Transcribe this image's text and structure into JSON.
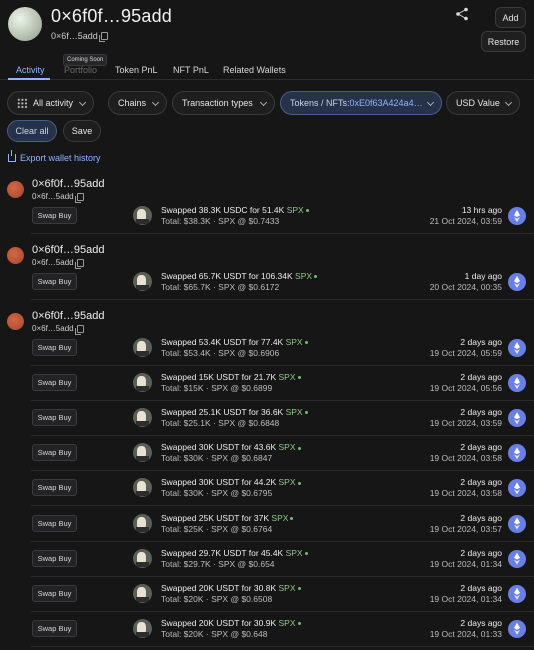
{
  "header": {
    "title": "0×6f0f…95add",
    "short_address": "0×6f…5add",
    "add_label": "Add",
    "restore_label": "Restore"
  },
  "tabs": [
    {
      "label": "Activity",
      "active": true
    },
    {
      "label": "Portfolio",
      "disabled": true
    },
    {
      "label": "Token PnL"
    },
    {
      "label": "NFT PnL"
    },
    {
      "label": "Related Wallets"
    }
  ],
  "tooltip": "Coming Soon",
  "filters": {
    "all_activity": "All activity",
    "chains": "Chains",
    "transaction_types": "Transaction types",
    "tokens_prefix": "Tokens / NFTs: ",
    "tokens_value": "0xE0f63A424a4…",
    "usd_value": "USD Value"
  },
  "actions": {
    "clear_all": "Clear all",
    "save": "Save",
    "export": "Export wallet history"
  },
  "colors": {
    "accent": "#8fb6ff",
    "spx": "#8fc98a",
    "eth": "#6a7fe6",
    "avatar": "#c45a38"
  },
  "groups": [
    {
      "name": "0×6f0f…95add",
      "sub": "0×6f…5add",
      "txs": [
        {
          "action": "Swap Buy",
          "from": "Swapped 38.3K USDC for 51.4K ",
          "token": "SPX",
          "total": "Total: $38.3K · SPX @ $0.7433",
          "when": "13 hrs ago",
          "date": "21 Oct 2024, 03:59"
        }
      ]
    },
    {
      "name": "0×6f0f…95add",
      "sub": "0×6f…5add",
      "txs": [
        {
          "action": "Swap Buy",
          "from": "Swapped 65.7K USDT for 106.34K ",
          "token": "SPX",
          "total": "Total: $65.7K · SPX @ $0.6172",
          "when": "1 day ago",
          "date": "20 Oct 2024, 00:35"
        }
      ]
    },
    {
      "name": "0×6f0f…95add",
      "sub": "0×6f…5add",
      "txs": [
        {
          "action": "Swap Buy",
          "from": "Swapped 53.4K USDT for 77.4K ",
          "token": "SPX",
          "total": "Total: $53.4K · SPX @ $0.6906",
          "when": "2 days ago",
          "date": "19 Oct 2024, 05:59"
        },
        {
          "action": "Swap Buy",
          "from": "Swapped 15K USDT for 21.7K ",
          "token": "SPX",
          "total": "Total: $15K · SPX @ $0.6899",
          "when": "2 days ago",
          "date": "19 Oct 2024, 05:56"
        },
        {
          "action": "Swap Buy",
          "from": "Swapped 25.1K USDT for 36.6K ",
          "token": "SPX",
          "total": "Total: $25.1K · SPX @ $0.6848",
          "when": "2 days ago",
          "date": "19 Oct 2024, 03:59"
        },
        {
          "action": "Swap Buy",
          "from": "Swapped 30K USDT for 43.6K ",
          "token": "SPX",
          "total": "Total: $30K · SPX @ $0.6847",
          "when": "2 days ago",
          "date": "19 Oct 2024, 03:58"
        },
        {
          "action": "Swap Buy",
          "from": "Swapped 30K USDT for 44.2K ",
          "token": "SPX",
          "total": "Total: $30K · SPX @ $0.6795",
          "when": "2 days ago",
          "date": "19 Oct 2024, 03:58"
        },
        {
          "action": "Swap Buy",
          "from": "Swapped 25K USDT for 37K ",
          "token": "SPX",
          "total": "Total: $25K · SPX @ $0.6764",
          "when": "2 days ago",
          "date": "19 Oct 2024, 03:57"
        },
        {
          "action": "Swap Buy",
          "from": "Swapped 29.7K USDT for 45.4K ",
          "token": "SPX",
          "total": "Total: $29.7K · SPX @ $0.654",
          "when": "2 days ago",
          "date": "19 Oct 2024, 01:34"
        },
        {
          "action": "Swap Buy",
          "from": "Swapped 20K USDT for 30.8K ",
          "token": "SPX",
          "total": "Total: $20K · SPX @ $0.6508",
          "when": "2 days ago",
          "date": "19 Oct 2024, 01:34"
        },
        {
          "action": "Swap Buy",
          "from": "Swapped 20K USDT for 30.9K ",
          "token": "SPX",
          "total": "Total: $20K · SPX @ $0.648",
          "when": "2 days ago",
          "date": "19 Oct 2024, 01:33"
        }
      ]
    }
  ]
}
